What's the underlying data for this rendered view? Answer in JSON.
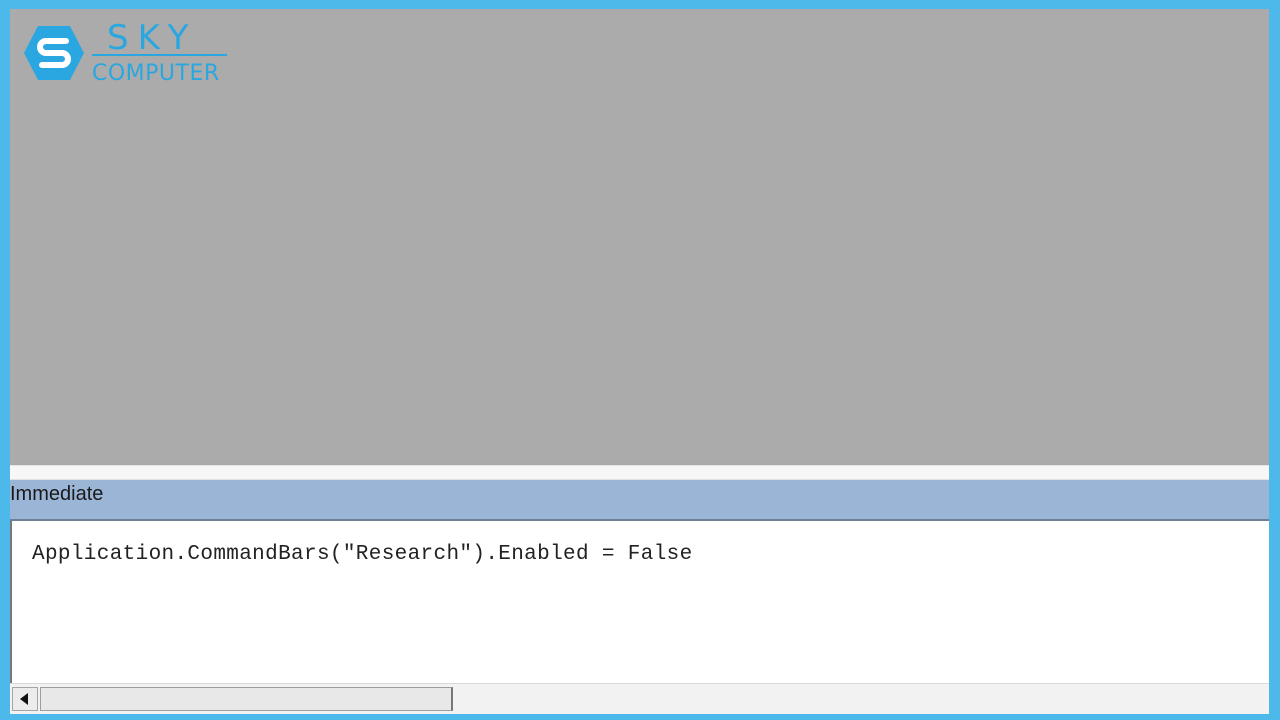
{
  "logo": {
    "name": "SKY",
    "subtitle": "COMPUTER"
  },
  "immediate_window": {
    "title": "Immediate",
    "code": "Application.CommandBars(\"Research\").Enabled = False"
  },
  "colors": {
    "background_border": "#4db8ea",
    "mdi_area": "#ababab",
    "titlebar": "#9bb5d6",
    "brand": "#2aa7e0"
  },
  "icons": {
    "scroll_left": "left-arrow-icon",
    "logo_mark": "sky-computer-logo-icon"
  }
}
